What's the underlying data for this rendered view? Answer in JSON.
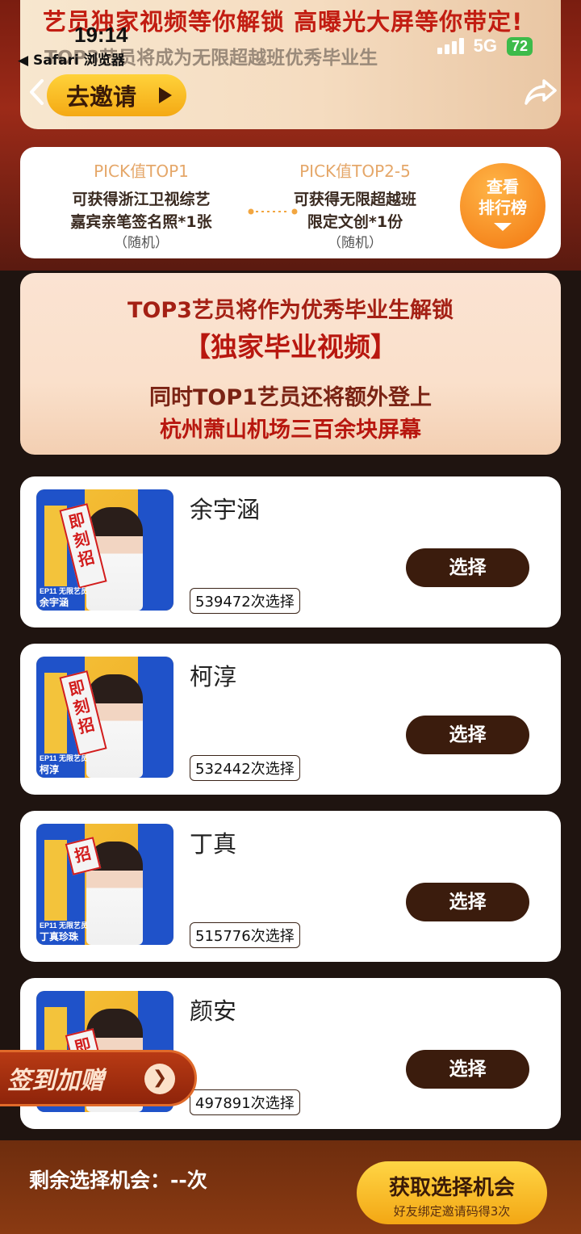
{
  "status": {
    "time": "19:14",
    "back_app": "◀ Safari 浏览器",
    "network": "5G",
    "battery": "72"
  },
  "hero": {
    "headline": "艺员独家视频等你解锁  高曝光大屏等你带定!",
    "subline": "TOP3艺员将成为无限超越班优秀毕业生",
    "invite_label": "去邀请"
  },
  "prizes": {
    "one": {
      "title": "PICK值TOP1",
      "line1": "可获得浙江卫视综艺",
      "line2": "嘉宾亲笔签名照*1张",
      "note": "（随机）"
    },
    "two": {
      "title": "PICK值TOP2-5",
      "line1": "可获得无限超越班",
      "line2": "限定文创*1份",
      "note": "（随机）"
    },
    "rank_line1": "查看",
    "rank_line2": "排行榜"
  },
  "promo": {
    "line1": "TOP3艺员将作为优秀毕业生解锁",
    "line2": "【独家毕业视频】",
    "line3": "同时TOP1艺员还将额外登上",
    "line4": "杭州萧山机场三百余块屏幕"
  },
  "candidates": [
    {
      "name": "余宇涵",
      "count": "539472次选择",
      "thumb_ep": "EP11 无限艺员",
      "thumb_name": "余宇涵",
      "banner": "即刻招"
    },
    {
      "name": "柯淳",
      "count": "532442次选择",
      "thumb_ep": "EP11 无限艺员",
      "thumb_name": "柯淳",
      "banner": "即刻招"
    },
    {
      "name": "丁真",
      "count": "515776次选择",
      "thumb_ep": "EP11 无限艺员",
      "thumb_name": "丁真珍珠",
      "banner": "招"
    },
    {
      "name": "颜安",
      "count": "497891次选择",
      "thumb_ep": "",
      "thumb_name": "",
      "banner": "即"
    }
  ],
  "select_label": "选择",
  "signin": {
    "label": "签到加赠"
  },
  "bottom": {
    "remaining": "剩余选择机会：--次",
    "get_main": "获取选择机会",
    "get_sub": "好友绑定邀请码得3次"
  },
  "colors": {
    "accent": "#f4a914",
    "dark_button": "#3b1c0d",
    "brand_red": "#c21d12"
  }
}
